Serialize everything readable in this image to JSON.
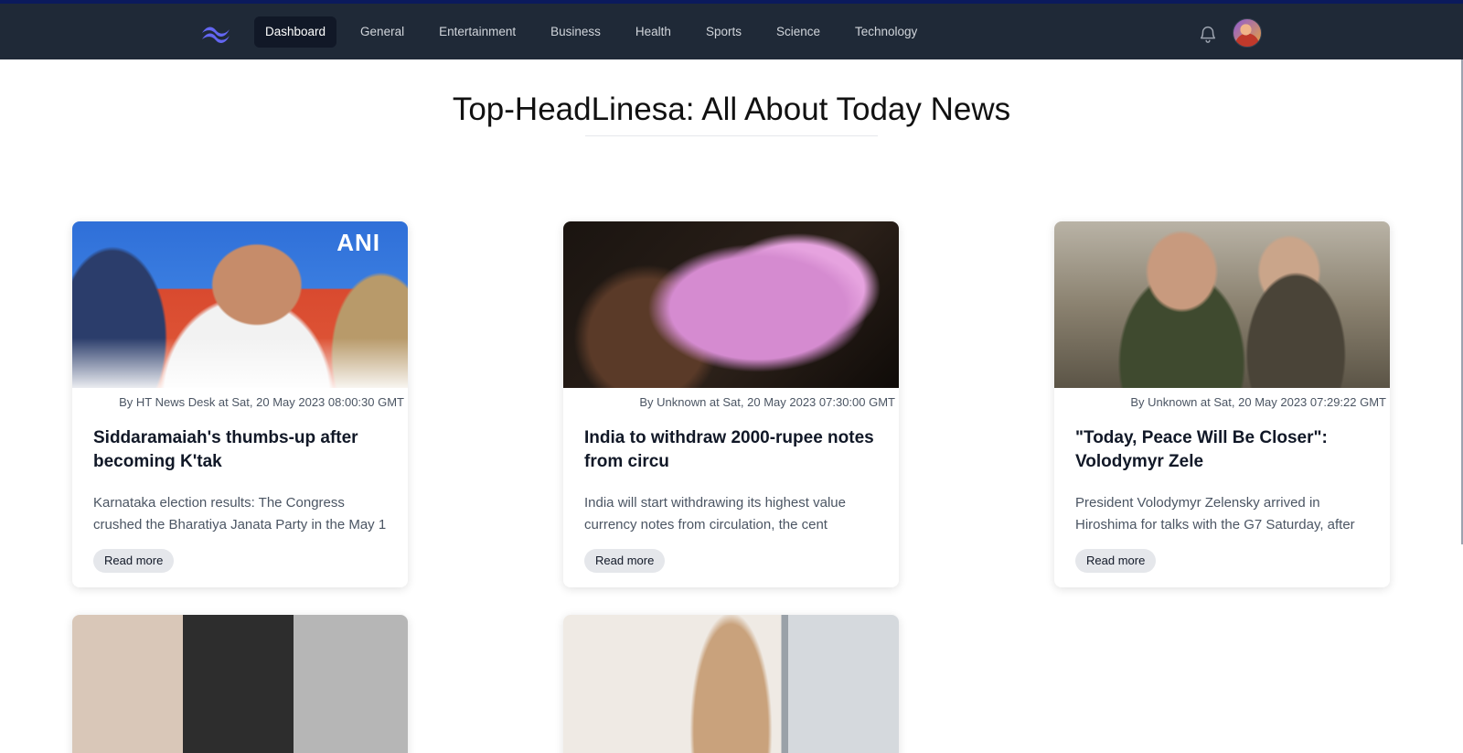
{
  "nav": {
    "links": [
      "Dashboard",
      "General",
      "Entertainment",
      "Business",
      "Health",
      "Sports",
      "Science",
      "Technology"
    ],
    "active": "Dashboard"
  },
  "page": {
    "title": "Top-HeadLinesa: All About Today News"
  },
  "cards": [
    {
      "meta": "By HT News Desk at Sat, 20 May 2023 08:00:30 GMT",
      "title": "Siddaramaiah's thumbs-up after becoming K'tak",
      "description": "Karnataka election results: The Congress crushed the Bharatiya Janata Party in the May 1",
      "button": "Read more",
      "image_watermark": "ANI"
    },
    {
      "meta": "By Unknown at Sat, 20 May 2023 07:30:00 GMT",
      "title": "India to withdraw 2000-rupee notes from circu",
      "description": "India will start withdrawing its highest value currency notes from circulation, the cent",
      "button": "Read more"
    },
    {
      "meta": "By Unknown at Sat, 20 May 2023 07:29:22 GMT",
      "title": "\"Today, Peace Will Be Closer\": Volodymyr Zele",
      "description": "President Volodymyr Zelensky arrived in Hiroshima for talks with the G7 Saturday, after",
      "button": "Read more"
    }
  ],
  "icons": {
    "logo": "tailwind-logo-icon",
    "bell": "bell-icon",
    "avatar": "user-avatar"
  },
  "colors": {
    "navbar": "#1f2937",
    "accent": "#6366f1",
    "button_bg": "#e5e7eb"
  }
}
